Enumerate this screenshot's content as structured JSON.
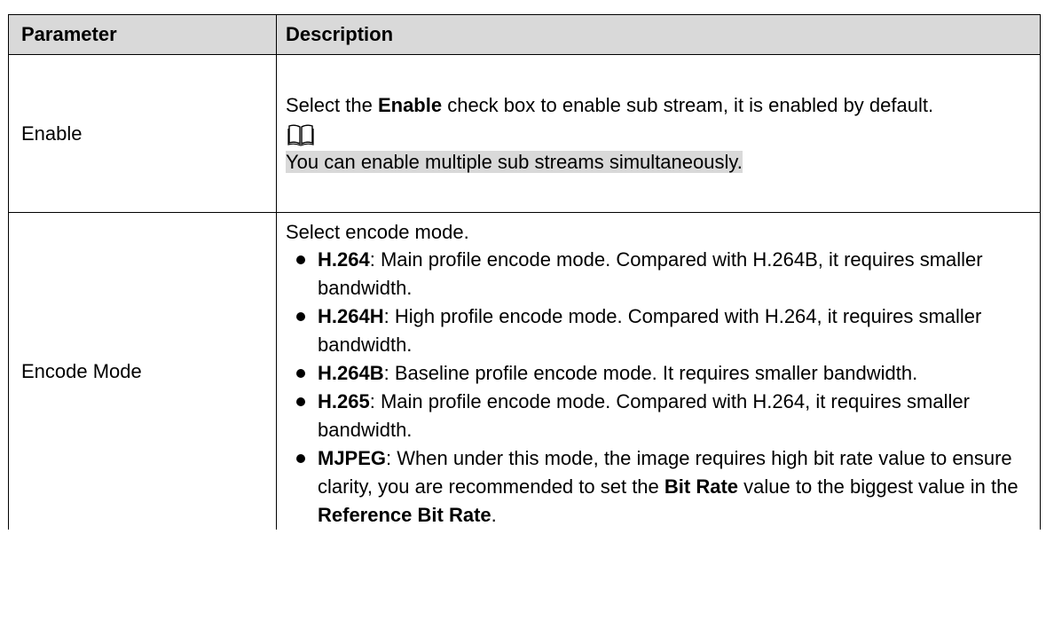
{
  "table": {
    "headers": [
      "Parameter",
      "Description"
    ],
    "rows": [
      {
        "parameter": "Enable",
        "description": {
          "pre": "Select the ",
          "bold": "Enable",
          "post": " check box to enable sub stream, it is enabled by default.",
          "note_icon": "book-note-icon",
          "note": "You can enable multiple sub streams simultaneously."
        }
      },
      {
        "parameter": "Encode Mode",
        "description": {
          "intro": "Select encode mode.",
          "items": [
            {
              "term": "H.264",
              "text": ": Main profile encode mode. Compared with H.264B, it requires smaller bandwidth."
            },
            {
              "term": "H.264H",
              "text": ": High profile encode mode. Compared with H.264, it requires smaller bandwidth."
            },
            {
              "term": "H.264B",
              "text": ": Baseline profile encode mode. It requires smaller bandwidth."
            },
            {
              "term": "H.265",
              "text": ": Main profile encode mode. Compared with H.264, it requires smaller bandwidth."
            },
            {
              "term": "MJPEG",
              "text": ": When under this mode, the image requires high bit rate value to ensure clarity, you are recommended to set the ",
              "bold2": "Bit Rate",
              "text2": " value to the biggest value in the ",
              "bold3": "Reference Bit Rate",
              "text3": "."
            }
          ]
        }
      }
    ]
  }
}
